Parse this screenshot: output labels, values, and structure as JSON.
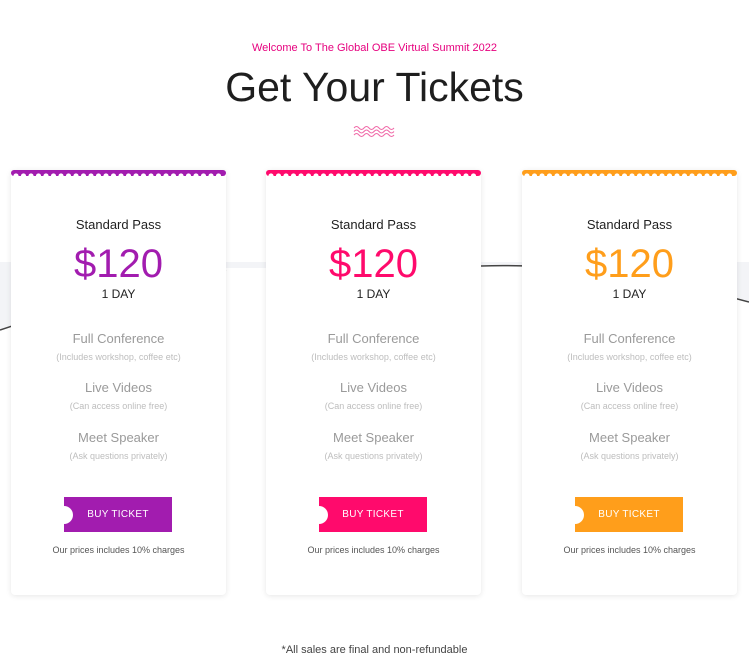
{
  "header": {
    "welcome": "Welcome To The Global OBE Virtual Summit 2022",
    "title": "Get Your Tickets"
  },
  "cards": [
    {
      "pass_name": "Standard Pass",
      "price": "$120",
      "period": "1 DAY",
      "color": "#a21caf",
      "features": [
        {
          "name": "Full Conference",
          "desc": "(Includes workshop, coffee etc)"
        },
        {
          "name": "Live Videos",
          "desc": "(Can access online free)"
        },
        {
          "name": "Meet Speaker",
          "desc": "(Ask questions privately)"
        }
      ],
      "button_label": "BUY TICKET",
      "note": "Our prices includes 10% charges"
    },
    {
      "pass_name": "Standard Pass",
      "price": "$120",
      "period": "1 DAY",
      "color": "#ff0a6c",
      "features": [
        {
          "name": "Full Conference",
          "desc": "(Includes workshop, coffee etc)"
        },
        {
          "name": "Live Videos",
          "desc": "(Can access online free)"
        },
        {
          "name": "Meet Speaker",
          "desc": "(Ask questions privately)"
        }
      ],
      "button_label": "BUY TICKET",
      "note": "Our prices includes 10% charges"
    },
    {
      "pass_name": "Standard Pass",
      "price": "$120",
      "period": "1 DAY",
      "color": "#ff9e1b",
      "features": [
        {
          "name": "Full Conference",
          "desc": "(Includes workshop, coffee etc)"
        },
        {
          "name": "Live Videos",
          "desc": "(Can access online free)"
        },
        {
          "name": "Meet Speaker",
          "desc": "(Ask questions privately)"
        }
      ],
      "button_label": "BUY TICKET",
      "note": "Our prices includes 10% charges"
    }
  ],
  "footer": {
    "note": "*All sales are final and non-refundable"
  },
  "colors": {
    "welcome": "#e6007e",
    "squiggle": "#f06aa8"
  }
}
